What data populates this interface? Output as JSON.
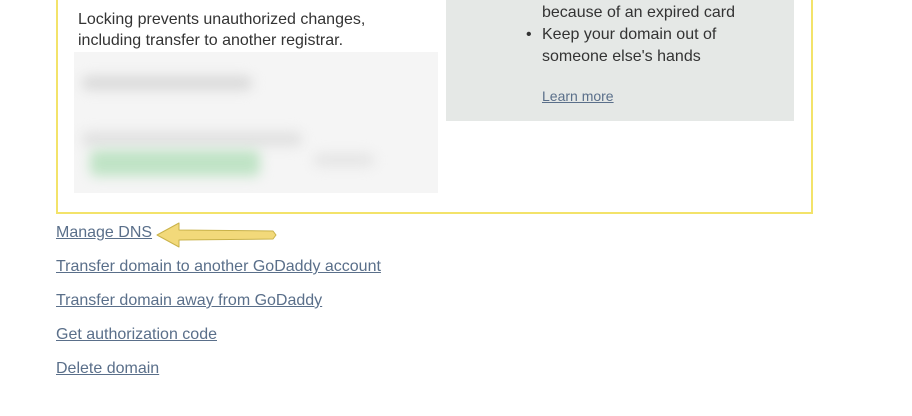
{
  "lock_description": "Locking prevents unauthorized changes, including transfer to another registrar.",
  "info_box": {
    "lines": [
      {
        "text": "because of an expired card",
        "bullet": false
      },
      {
        "text": "Keep your domain out of",
        "bullet": true
      },
      {
        "text": "someone else's hands",
        "bullet": false
      }
    ],
    "learn_more_label": "Learn more"
  },
  "links": {
    "manage_dns": "Manage DNS",
    "transfer_godaddy_account": "Transfer domain to another GoDaddy account",
    "transfer_away": "Transfer domain away from GoDaddy",
    "get_auth_code": "Get authorization code",
    "delete_domain": "Delete domain"
  },
  "colors": {
    "panel_border": "#f3e36a",
    "info_box_bg": "#e5e8e6",
    "link": "#5a6f8a",
    "arrow": "#f2d97a"
  },
  "annotation": {
    "arrow_icon": "left-arrow-icon"
  }
}
